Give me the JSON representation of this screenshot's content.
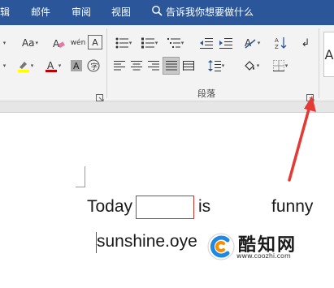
{
  "ribbon_tabs": [
    {
      "label": "辑"
    },
    {
      "label": "邮件"
    },
    {
      "label": "审阅"
    },
    {
      "label": "视图"
    }
  ],
  "tell_me": {
    "text": "告诉我你想要做什么",
    "icon": "lightbulb-icon"
  },
  "font_group": {
    "font_size_label": "Aa",
    "phonetic_label": "wén",
    "enclose_label": "A",
    "font_color": "#c00000",
    "highlight_color": "#ffff00"
  },
  "paragraph_group": {
    "label": "段落"
  },
  "document": {
    "line1": {
      "word1": "Today",
      "word2": "is",
      "word3": "funny"
    },
    "line2": "sunshine.oye"
  },
  "watermark": {
    "name": "酷知网",
    "url": "www.coozhi.com"
  },
  "colors": {
    "ribbon_blue": "#2b579a",
    "arrow_red": "#e53935"
  }
}
